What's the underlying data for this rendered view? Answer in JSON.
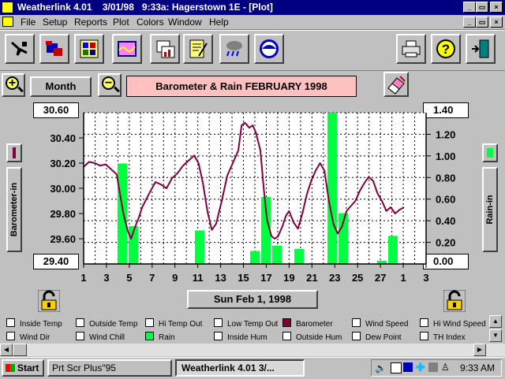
{
  "window": {
    "title": "Weatherlink 4.01    3/01/98   9:33a: Hagerstown 1E - [Plot]",
    "caption_buttons": [
      "_",
      "▭",
      "×"
    ],
    "doc_buttons": [
      "_",
      "▭",
      "×"
    ]
  },
  "menu": [
    "File",
    "Setup",
    "Reports",
    "Plot",
    "Colors",
    "Window",
    "Help"
  ],
  "toolbar": {
    "left": [
      "tools-icon",
      "station-icon",
      "summary-icon",
      "graph-icon",
      "chart-icon",
      "notes-icon",
      "weather-icon",
      "noaa-icon"
    ],
    "right": [
      "printer-icon",
      "help-icon",
      "exit-icon"
    ]
  },
  "controls": {
    "zoom_in": "+",
    "zoom_out": "−",
    "period": "Month",
    "plot_title": "Barometer & Rain  FEBRUARY 1998",
    "date_button": "Sun Feb 1, 1998",
    "left_axis_box": "30.60",
    "bottom_left_box": "29.40",
    "right_axis_box": "1.40",
    "bottom_right_box": "0.00",
    "left_axis_label": "Barometer-in",
    "right_axis_label": "Rain-in"
  },
  "chart_data": {
    "type": "bar+line",
    "x_ticks": [
      "1",
      "3",
      "5",
      "7",
      "9",
      "11",
      "13",
      "15",
      "17",
      "19",
      "21",
      "23",
      "25",
      "27",
      "1",
      "3"
    ],
    "left_axis": {
      "label": "Barometer-in",
      "ticks": [
        "30.60",
        "30.40",
        "30.20",
        "30.00",
        "29.80",
        "29.60",
        "29.40"
      ],
      "ylim": [
        29.4,
        30.6
      ]
    },
    "right_axis": {
      "label": "Rain-in",
      "ticks": [
        "1.40",
        "1.20",
        "1.00",
        "0.80",
        "0.60",
        "0.40",
        "0.20",
        "0.00"
      ],
      "ylim": [
        0,
        1.4
      ]
    },
    "xlim": [
      1,
      32
    ],
    "series": [
      {
        "name": "Barometer",
        "color": "#800040",
        "x": [
          1,
          1.5,
          2,
          2.5,
          3,
          3.5,
          4,
          4.3,
          4.6,
          5,
          5.3,
          5.6,
          6,
          6.3,
          7,
          7.5,
          8,
          8.5,
          9,
          9.5,
          10,
          10.5,
          11,
          11.4,
          11.8,
          12.2,
          12.6,
          13,
          13.5,
          14,
          14.5,
          15,
          15.3,
          15.6,
          16,
          16.3,
          16.6,
          17,
          17.3,
          17.6,
          18,
          18.3,
          18.6,
          19,
          19.3,
          19.6,
          20,
          20.4,
          20.8,
          21.2,
          21.6,
          22,
          22.4,
          22.8,
          23.2,
          23.6,
          24,
          24.4,
          24.8,
          25.2,
          25.6,
          26,
          26.4,
          26.8,
          27.2,
          27.6,
          28,
          28.4,
          28.8,
          29.2,
          29.6,
          30
        ],
        "values": [
          30.17,
          30.21,
          30.2,
          30.18,
          30.19,
          30.15,
          30.11,
          29.95,
          29.8,
          29.66,
          29.6,
          29.68,
          29.77,
          29.85,
          29.97,
          30.05,
          30.03,
          30.0,
          30.08,
          30.12,
          30.18,
          30.22,
          30.26,
          30.2,
          30.04,
          29.82,
          29.67,
          29.72,
          29.9,
          30.1,
          30.2,
          30.3,
          30.5,
          30.52,
          30.48,
          30.5,
          30.44,
          30.3,
          30.0,
          29.75,
          29.62,
          29.6,
          29.62,
          29.7,
          29.78,
          29.82,
          29.73,
          29.68,
          29.8,
          29.95,
          30.06,
          30.14,
          30.2,
          30.14,
          29.9,
          29.72,
          29.64,
          29.7,
          29.82,
          29.86,
          29.9,
          29.98,
          30.04,
          30.09,
          30.06,
          29.96,
          29.9,
          29.82,
          29.85,
          29.8,
          29.83,
          29.85
        ]
      },
      {
        "name": "Rain",
        "color": "#00ff40",
        "x": [
          4.5,
          5.5,
          11.5,
          16.5,
          17.5,
          18.5,
          20.5,
          23.5,
          24.5,
          28,
          29
        ],
        "values": [
          0.93,
          0.35,
          0.31,
          0.12,
          0.62,
          0.17,
          0.14,
          1.4,
          0.47,
          0.03,
          0.26
        ]
      }
    ]
  },
  "legend": [
    {
      "label": "Inside Temp",
      "checked": false
    },
    {
      "label": "Outside Temp",
      "checked": false
    },
    {
      "label": "Hi Temp Out",
      "checked": false
    },
    {
      "label": "Low Temp Out",
      "checked": false
    },
    {
      "label": "Barometer",
      "checked": true,
      "color": "#800040"
    },
    {
      "label": "Wind Speed",
      "checked": false
    },
    {
      "label": "Hi Wind Speed",
      "checked": false
    },
    {
      "label": "Wind Dir",
      "checked": false
    },
    {
      "label": "Wind Chill",
      "checked": false
    },
    {
      "label": "Rain",
      "checked": true,
      "color": "#00ff40"
    },
    {
      "label": "Inside Hum",
      "checked": false
    },
    {
      "label": "Outside Hum",
      "checked": false
    },
    {
      "label": "Dew Point",
      "checked": false
    },
    {
      "label": "TH Index",
      "checked": false
    }
  ],
  "taskbar": {
    "start": "Start",
    "tasks": [
      "Prt Scr Plus\"95",
      "Weatherlink 4.01     3/..."
    ],
    "clock": "9:33 AM"
  }
}
